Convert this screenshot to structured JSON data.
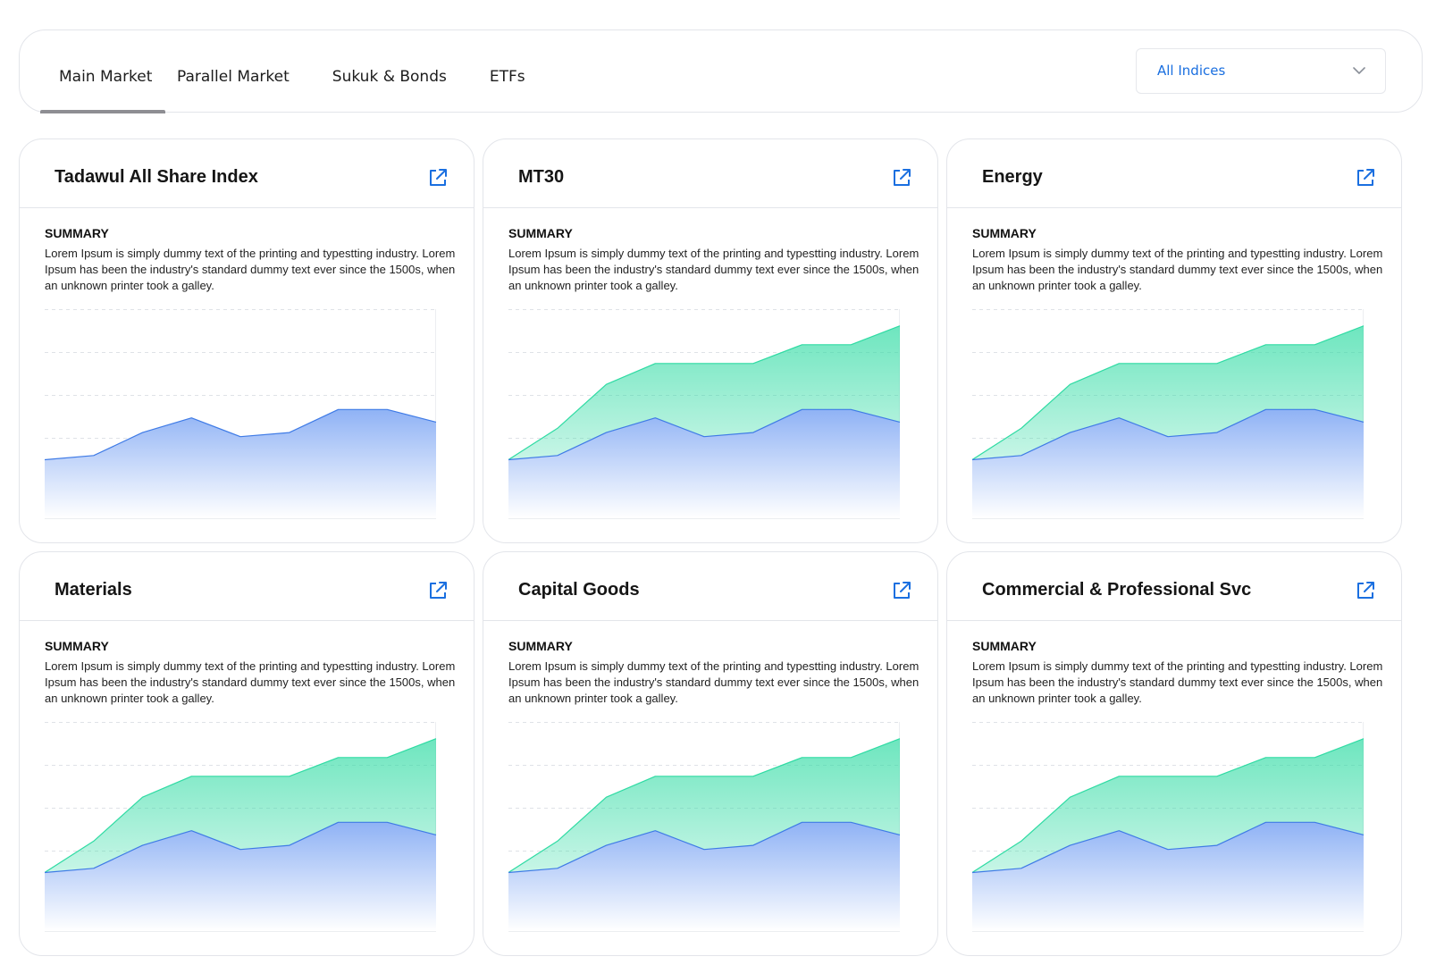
{
  "tabs": [
    {
      "label": "Main Market",
      "active": true
    },
    {
      "label": "Parallel Market",
      "active": false
    },
    {
      "label": "Sukuk & Bonds",
      "active": false
    },
    {
      "label": "ETFs",
      "active": false
    }
  ],
  "filter": {
    "selected": "All Indices",
    "icon": "chevron-down-icon"
  },
  "colors": {
    "accent": "#1a6fe0",
    "green_series": "#2fdba3",
    "blue_series": "#3f7be6",
    "border": "#e3e5ea",
    "active_tab_indicator": "#8e8e93"
  },
  "cards": [
    {
      "title": "Tadawul All Share Index",
      "summary_label": "SUMMARY",
      "summary": "Lorem Ipsum is simply dummy text of the printing and typestting industry. Lorem Ipsum has been the industry's standard dummy text ever since the 1500s, when an unknown printer took a galley.",
      "link_icon": "external-link-icon"
    },
    {
      "title": "MT30",
      "summary_label": "SUMMARY",
      "summary": "Lorem Ipsum is simply dummy text of the printing and typestting industry. Lorem Ipsum has been the industry's standard dummy text ever since the 1500s, when an unknown printer took a galley.",
      "link_icon": "external-link-icon"
    },
    {
      "title": "Energy",
      "summary_label": "SUMMARY",
      "summary": "Lorem Ipsum is simply dummy text of the printing and typestting industry. Lorem Ipsum has been the industry's standard dummy text ever since the 1500s, when an unknown printer took a galley.",
      "link_icon": "external-link-icon"
    },
    {
      "title": "Materials",
      "summary_label": "SUMMARY",
      "summary": "Lorem Ipsum is simply dummy text of the printing and typestting industry. Lorem Ipsum has been the industry's standard dummy text ever since the 1500s, when an unknown printer took a galley.",
      "link_icon": "external-link-icon"
    },
    {
      "title": "Capital Goods",
      "summary_label": "SUMMARY",
      "summary": "Lorem Ipsum is simply dummy text of the printing and typestting industry. Lorem Ipsum has been the industry's standard dummy text ever since the 1500s, when an unknown printer took a galley.",
      "link_icon": "external-link-icon"
    },
    {
      "title": "Commercial & Professional Svc",
      "summary_label": "SUMMARY",
      "summary": "Lorem Ipsum is simply dummy text of the printing and typestting industry. Lorem Ipsum has been the industry's standard dummy text ever since the 1500s, when an unknown printer took a galley.",
      "link_icon": "external-link-icon"
    }
  ],
  "chart_data": [
    {
      "type": "area",
      "ylim": [
        0,
        100
      ],
      "grid": true,
      "series": [
        {
          "values": [
            28,
            30,
            41,
            48,
            39,
            41,
            52,
            52,
            46
          ]
        }
      ]
    },
    {
      "type": "area",
      "ylim": [
        0,
        100
      ],
      "grid": true,
      "series": [
        {
          "values": [
            28,
            43,
            64,
            74,
            74,
            74,
            83,
            83,
            92
          ]
        },
        {
          "values": [
            28,
            30,
            41,
            48,
            39,
            41,
            52,
            52,
            46
          ]
        }
      ]
    },
    {
      "type": "area",
      "ylim": [
        0,
        100
      ],
      "grid": true,
      "series": [
        {
          "values": [
            28,
            43,
            64,
            74,
            74,
            74,
            83,
            83,
            92
          ]
        },
        {
          "values": [
            28,
            30,
            41,
            48,
            39,
            41,
            52,
            52,
            46
          ]
        }
      ]
    },
    {
      "type": "area",
      "ylim": [
        0,
        100
      ],
      "grid": true,
      "series": [
        {
          "values": [
            28,
            43,
            64,
            74,
            74,
            74,
            83,
            83,
            92
          ]
        },
        {
          "values": [
            28,
            30,
            41,
            48,
            39,
            41,
            52,
            52,
            46
          ]
        }
      ]
    },
    {
      "type": "area",
      "ylim": [
        0,
        100
      ],
      "grid": true,
      "series": [
        {
          "values": [
            28,
            43,
            64,
            74,
            74,
            74,
            83,
            83,
            92
          ]
        },
        {
          "values": [
            28,
            30,
            41,
            48,
            39,
            41,
            52,
            52,
            46
          ]
        }
      ]
    },
    {
      "type": "area",
      "ylim": [
        0,
        100
      ],
      "grid": true,
      "series": [
        {
          "values": [
            28,
            43,
            64,
            74,
            74,
            74,
            83,
            83,
            92
          ]
        },
        {
          "values": [
            28,
            30,
            41,
            48,
            39,
            41,
            52,
            52,
            46
          ]
        }
      ]
    }
  ]
}
